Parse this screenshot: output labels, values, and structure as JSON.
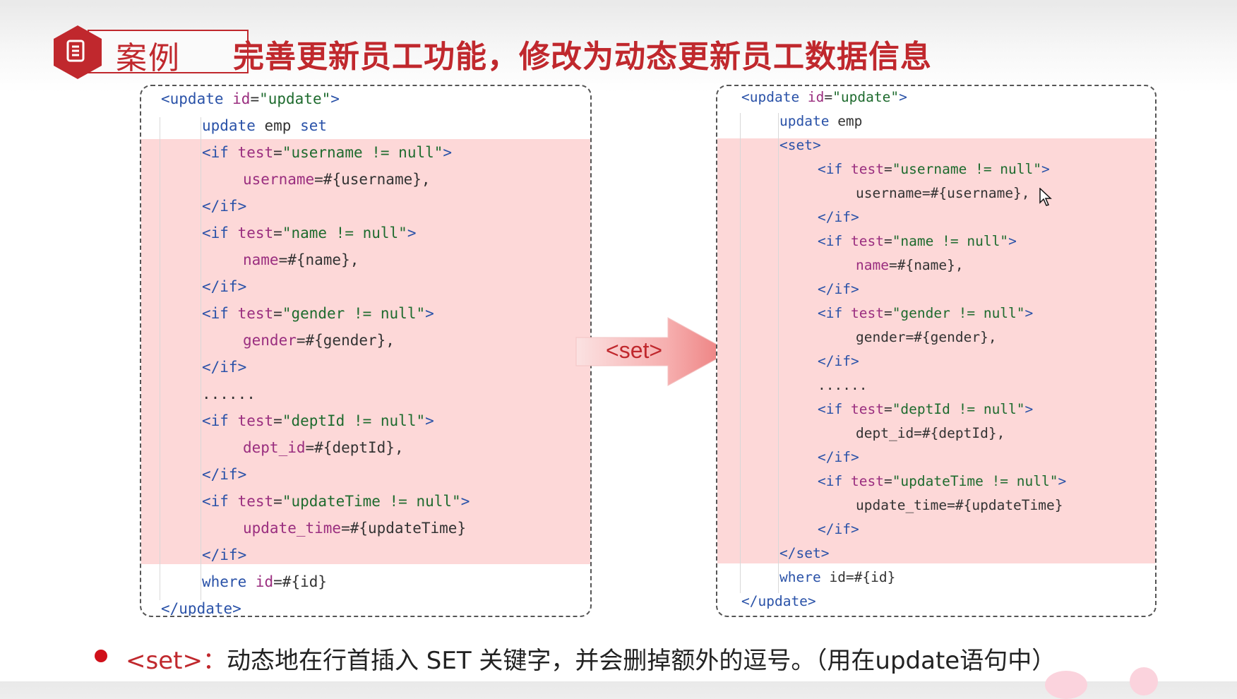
{
  "header": {
    "badge_label": "案例",
    "title": "完善更新员工功能，修改为动态更新员工数据信息"
  },
  "arrow": {
    "label": "<set>"
  },
  "left_code": [
    {
      "indent": 0,
      "parts": [
        [
          "k",
          "<update "
        ],
        [
          "a",
          "id"
        ],
        [
          "d",
          "="
        ],
        [
          "s",
          "\"update\""
        ],
        [
          "k",
          ">"
        ]
      ]
    },
    {
      "indent": 1,
      "parts": [
        [
          "k",
          "update"
        ],
        [
          "d",
          " emp "
        ],
        [
          "k",
          "set"
        ]
      ]
    },
    {
      "indent": 1,
      "parts": [
        [
          "k",
          "<if "
        ],
        [
          "a",
          "test"
        ],
        [
          "d",
          "="
        ],
        [
          "s",
          "\"username != null\""
        ],
        [
          "k",
          ">"
        ]
      ]
    },
    {
      "indent": 2,
      "parts": [
        [
          "a",
          "username"
        ],
        [
          "d",
          "=#{username},"
        ]
      ]
    },
    {
      "indent": 1,
      "parts": [
        [
          "k",
          "</if>"
        ]
      ]
    },
    {
      "indent": 1,
      "parts": [
        [
          "k",
          "<if "
        ],
        [
          "a",
          "test"
        ],
        [
          "d",
          "="
        ],
        [
          "s",
          "\"name != null\""
        ],
        [
          "k",
          ">"
        ]
      ]
    },
    {
      "indent": 2,
      "parts": [
        [
          "a",
          "name"
        ],
        [
          "d",
          "=#{name},"
        ]
      ]
    },
    {
      "indent": 1,
      "parts": [
        [
          "k",
          "</if>"
        ]
      ]
    },
    {
      "indent": 1,
      "parts": [
        [
          "k",
          "<if "
        ],
        [
          "a",
          "test"
        ],
        [
          "d",
          "="
        ],
        [
          "s",
          "\"gender != null\""
        ],
        [
          "k",
          ">"
        ]
      ]
    },
    {
      "indent": 2,
      "parts": [
        [
          "a",
          "gender"
        ],
        [
          "d",
          "=#{gender},"
        ]
      ]
    },
    {
      "indent": 1,
      "parts": [
        [
          "k",
          "</if>"
        ]
      ]
    },
    {
      "indent": 1,
      "parts": [
        [
          "d",
          "......"
        ]
      ]
    },
    {
      "indent": 1,
      "parts": [
        [
          "k",
          "<if "
        ],
        [
          "a",
          "test"
        ],
        [
          "d",
          "="
        ],
        [
          "s",
          "\"deptId != null\""
        ],
        [
          "k",
          ">"
        ]
      ]
    },
    {
      "indent": 2,
      "parts": [
        [
          "a",
          "dept_id"
        ],
        [
          "d",
          "=#{deptId},"
        ]
      ]
    },
    {
      "indent": 1,
      "parts": [
        [
          "k",
          "</if>"
        ]
      ]
    },
    {
      "indent": 1,
      "parts": [
        [
          "k",
          "<if "
        ],
        [
          "a",
          "test"
        ],
        [
          "d",
          "="
        ],
        [
          "s",
          "\"updateTime != null\""
        ],
        [
          "k",
          ">"
        ]
      ]
    },
    {
      "indent": 2,
      "parts": [
        [
          "a",
          "update_time"
        ],
        [
          "d",
          "=#{updateTime}"
        ]
      ]
    },
    {
      "indent": 1,
      "parts": [
        [
          "k",
          "</if>"
        ]
      ]
    },
    {
      "indent": 1,
      "parts": [
        [
          "k",
          "where "
        ],
        [
          "a",
          "id"
        ],
        [
          "d",
          "=#{id}"
        ]
      ]
    },
    {
      "indent": 0,
      "parts": [
        [
          "k",
          "</update>"
        ]
      ]
    }
  ],
  "right_code": [
    {
      "indent": 0,
      "parts": [
        [
          "k",
          "<update "
        ],
        [
          "a",
          "id"
        ],
        [
          "d",
          "="
        ],
        [
          "s",
          "\"update\""
        ],
        [
          "k",
          ">"
        ]
      ]
    },
    {
      "indent": 1,
      "parts": [
        [
          "k",
          "update"
        ],
        [
          "d",
          " emp"
        ]
      ]
    },
    {
      "indent": 1,
      "parts": [
        [
          "k",
          "<set>"
        ]
      ]
    },
    {
      "indent": 2,
      "parts": [
        [
          "k",
          "<if "
        ],
        [
          "a",
          "test"
        ],
        [
          "d",
          "="
        ],
        [
          "s",
          "\"username != null\""
        ],
        [
          "k",
          ">"
        ]
      ]
    },
    {
      "indent": 3,
      "parts": [
        [
          "d",
          "username=#{username},"
        ]
      ]
    },
    {
      "indent": 2,
      "parts": [
        [
          "k",
          "</if>"
        ]
      ]
    },
    {
      "indent": 2,
      "parts": [
        [
          "k",
          "<if "
        ],
        [
          "a",
          "test"
        ],
        [
          "d",
          "="
        ],
        [
          "s",
          "\"name != null\""
        ],
        [
          "k",
          ">"
        ]
      ]
    },
    {
      "indent": 3,
      "parts": [
        [
          "a",
          "name"
        ],
        [
          "d",
          "=#{name},"
        ]
      ]
    },
    {
      "indent": 2,
      "parts": [
        [
          "k",
          "</if>"
        ]
      ]
    },
    {
      "indent": 2,
      "parts": [
        [
          "k",
          "<if "
        ],
        [
          "a",
          "test"
        ],
        [
          "d",
          "="
        ],
        [
          "s",
          "\"gender != null\""
        ],
        [
          "k",
          ">"
        ]
      ]
    },
    {
      "indent": 3,
      "parts": [
        [
          "d",
          "gender=#{gender},"
        ]
      ]
    },
    {
      "indent": 2,
      "parts": [
        [
          "k",
          "</if>"
        ]
      ]
    },
    {
      "indent": 2,
      "parts": [
        [
          "d",
          "......"
        ]
      ]
    },
    {
      "indent": 2,
      "parts": [
        [
          "k",
          "<if "
        ],
        [
          "a",
          "test"
        ],
        [
          "d",
          "="
        ],
        [
          "s",
          "\"deptId != null\""
        ],
        [
          "k",
          ">"
        ]
      ]
    },
    {
      "indent": 3,
      "parts": [
        [
          "d",
          "dept_id=#{deptId},"
        ]
      ]
    },
    {
      "indent": 2,
      "parts": [
        [
          "k",
          "</if>"
        ]
      ]
    },
    {
      "indent": 2,
      "parts": [
        [
          "k",
          "<if "
        ],
        [
          "a",
          "test"
        ],
        [
          "d",
          "="
        ],
        [
          "s",
          "\"updateTime != null\""
        ],
        [
          "k",
          ">"
        ]
      ]
    },
    {
      "indent": 3,
      "parts": [
        [
          "d",
          "update_time=#{updateTime}"
        ]
      ]
    },
    {
      "indent": 2,
      "parts": [
        [
          "k",
          "</if>"
        ]
      ]
    },
    {
      "indent": 1,
      "parts": [
        [
          "k",
          "</set>"
        ]
      ]
    },
    {
      "indent": 1,
      "parts": [
        [
          "k",
          "where "
        ],
        [
          "d",
          "id=#{id}"
        ]
      ]
    },
    {
      "indent": 0,
      "parts": [
        [
          "k",
          "</update>"
        ]
      ]
    }
  ],
  "note": {
    "keyword": "<set>：",
    "text": "动态地在行首插入 SET 关键字，并会删掉额外的逗号。（用在update语句中）"
  },
  "colors": {
    "accent": "#c0282d",
    "highlight": "#fdd8d8"
  }
}
